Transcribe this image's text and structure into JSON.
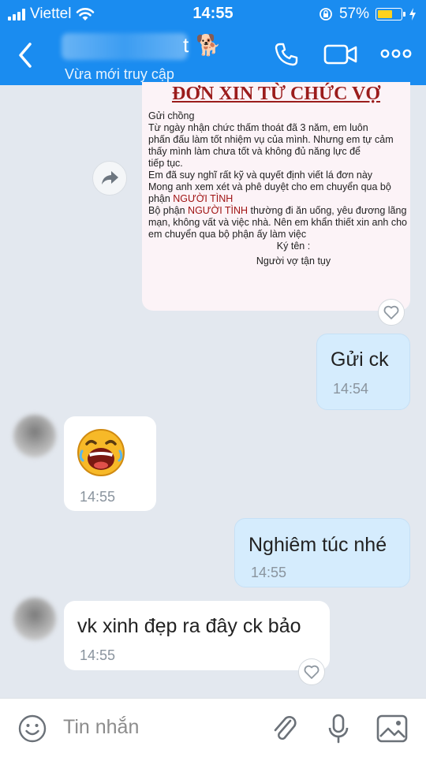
{
  "status": {
    "carrier": "Viettel",
    "time": "14:55",
    "battery": "57%"
  },
  "header": {
    "name_tail": "t",
    "name_emoji": "🐕",
    "subtitle": "Vừa mới truy cập",
    "icons": [
      "back-icon",
      "phone-icon",
      "video-icon",
      "more-icon"
    ]
  },
  "document": {
    "title": "ĐƠN XIN TỪ CHỨC VỢ",
    "lines": [
      "Gửi chồng",
      "Từ ngày nhận chức thấm thoát đã 3 năm, em luôn",
      "phấn đấu làm tốt nhiệm vụ của mình. Nhưng em tự cảm",
      "thấy mình làm chưa tốt và không đủ năng lực để",
      "tiếp tục.",
      "Em đã suy nghĩ rất kỹ và quyết định viết lá đơn này",
      "Mong anh xem xét và phê duyệt cho em chuyển qua bộ"
    ],
    "line8_prefix": "phận ",
    "highlight": "NGƯỜI TÌNH",
    "line9_prefix": "Bộ phận ",
    "line9_suffix": " thường đi ăn uống, yêu đương lãng",
    "lines_after": [
      "mạn, không vất và việc nhà. Nên em khẩn thiết xin anh cho",
      "em chuyển qua bộ phận ấy làm việc"
    ],
    "sign_label": "Ký tên :",
    "signature": "Người vợ tận tụy"
  },
  "messages": [
    {
      "direction": "out",
      "text": "Gửi ck",
      "time": "14:54"
    },
    {
      "direction": "in",
      "emoji": "laughing-sticker",
      "time": "14:55"
    },
    {
      "direction": "out",
      "text": "Nghiêm túc nhé",
      "time": "14:55"
    },
    {
      "direction": "in",
      "text": "vk xinh đẹp ra đây ck bảo",
      "time": "14:55"
    }
  ],
  "input": {
    "placeholder": "Tin nhắn",
    "icons": [
      "emoji-icon",
      "attach-icon",
      "microphone-icon",
      "image-icon"
    ]
  },
  "colors": {
    "header_bg": "#1a8cf0",
    "chat_bg": "#e3e8ef",
    "outgoing_bubble": "#d5ecfd",
    "incoming_bubble": "#ffffff",
    "battery_fill": "#ffd21f",
    "doc_title": "#9b1c1c"
  }
}
